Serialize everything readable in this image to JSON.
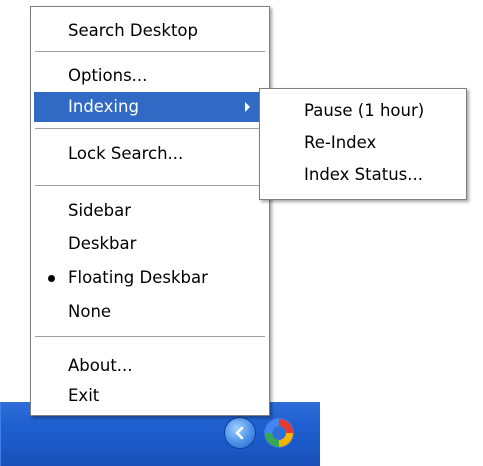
{
  "context_menu": {
    "items": [
      {
        "label": "Search Desktop"
      },
      {
        "label": "Options..."
      },
      {
        "label": "Indexing"
      },
      {
        "label": "Lock Search..."
      },
      {
        "label": "Sidebar"
      },
      {
        "label": "Deskbar"
      },
      {
        "label": "Floating Deskbar",
        "selected": true
      },
      {
        "label": "None"
      },
      {
        "label": "About..."
      },
      {
        "label": "Exit"
      }
    ]
  },
  "indexing_submenu": {
    "items": [
      {
        "label": "Pause (1 hour)"
      },
      {
        "label": "Re-Index"
      },
      {
        "label": "Index Status..."
      }
    ]
  },
  "system_tray": {
    "icons": [
      "show-hidden-icons-chevron",
      "google-desktop-icon"
    ]
  },
  "colors": {
    "highlight": "#316ac5",
    "taskbar": "#1f5fd0"
  }
}
